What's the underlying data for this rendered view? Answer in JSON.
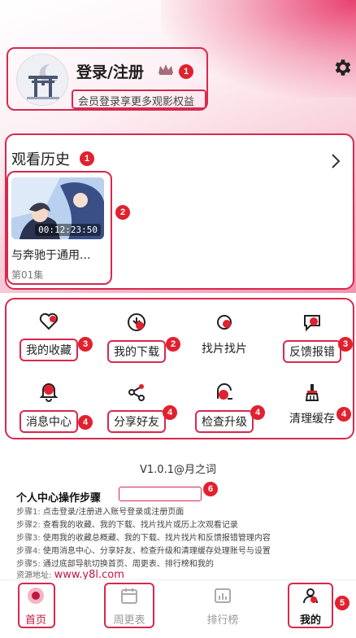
{
  "profile": {
    "login_label": "登录/注册",
    "member_tip": "会员登录享更多观影权益",
    "badge": "1"
  },
  "history": {
    "title": "观看历史",
    "title_badge": "1",
    "item_badge": "2",
    "items": [
      {
        "name": "与奔驰于通用...",
        "episode": "第01集",
        "time": "00:12:23:50"
      }
    ]
  },
  "features": [
    {
      "label": "我的收藏",
      "icon": "heart-icon",
      "badge": "3"
    },
    {
      "label": "我的下载",
      "icon": "download-icon",
      "badge": "2"
    },
    {
      "label": "找片找片",
      "icon": "find-icon",
      "badge": ""
    },
    {
      "label": "反馈报错",
      "icon": "feedback-icon",
      "badge": "3"
    },
    {
      "label": "消息中心",
      "icon": "bell-icon",
      "badge": "4"
    },
    {
      "label": "分享好友",
      "icon": "share-icon",
      "badge": "4"
    },
    {
      "label": "检查升级",
      "icon": "upgrade-icon",
      "badge": "4"
    },
    {
      "label": "清理缓存",
      "icon": "broom-icon",
      "badge": "4"
    }
  ],
  "version": "V1.0.1@月之词",
  "steps": {
    "title": "个人中心操作步骤",
    "badge": "6",
    "lines": [
      {
        "k": "步骤1:",
        "v": "点击登录/注册进入账号登录或注册页面"
      },
      {
        "k": "步骤2:",
        "v": "查看我的收藏、我的下载、找片找片或历上次观看记录"
      },
      {
        "k": "步骤3:",
        "v": "使用我的收藏总概藏、我的下载、找片找片和反馈报错管理内容"
      },
      {
        "k": "步骤4:",
        "v": "使用消息中心、分享好友、检查升级和清理缓存处理账号与设置"
      },
      {
        "k": "步骤5:",
        "v": "通过底部导航切换首页、周更表、排行榜和我的"
      }
    ],
    "source_label": "资源地址:",
    "source_url": "www.y8l.com"
  },
  "tabbar": {
    "badge": "5",
    "tabs": [
      {
        "label": "首页",
        "icon": "home-icon"
      },
      {
        "label": "周更表",
        "icon": "calendar-icon"
      },
      {
        "label": "排行榜",
        "icon": "chart-icon"
      },
      {
        "label": "我的",
        "icon": "user-icon"
      }
    ]
  },
  "colors": {
    "accent": "#d8284e",
    "badge": "#e0212f"
  }
}
